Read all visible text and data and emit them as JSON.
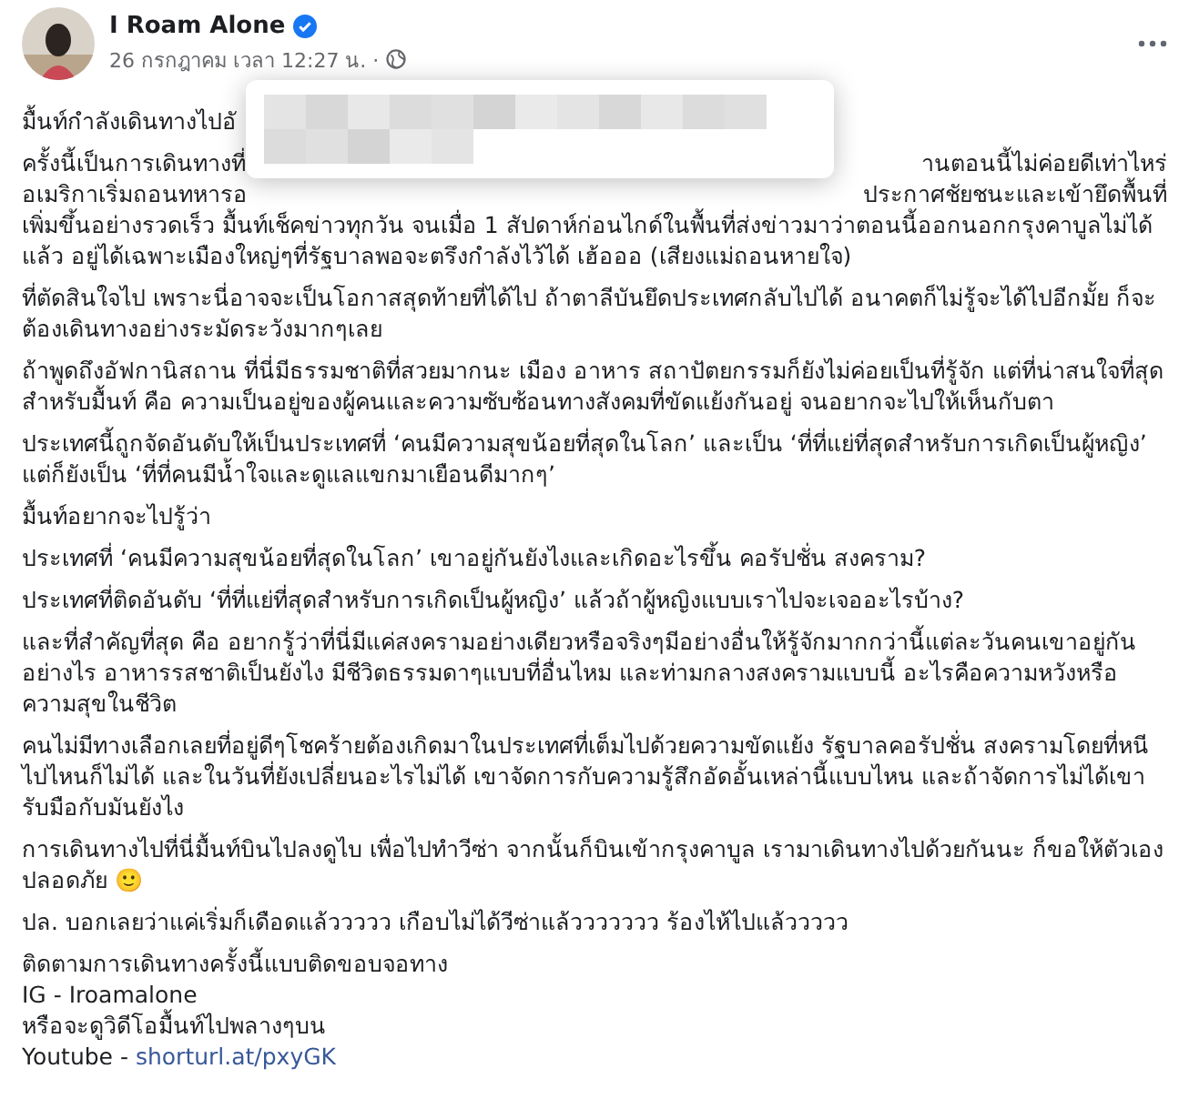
{
  "post": {
    "author": "I Roam Alone",
    "verified": true,
    "time": "26 กรกฎาคม เวลา 12:27 น. ·",
    "intro": "มื้นท์กำลังเดินทางไปอั",
    "partial_lines": [
      {
        "left": "ครั้งนี้เป็นการเดินทางที่",
        "right": "านตอนนี้ไม่ค่อยดีเท่าไหร่"
      },
      {
        "left": "อเมริกาเริ่มถอนทหารอ",
        "right": "ประกาศชัยชนะและเข้ายึดพื้นที่"
      }
    ],
    "continuation": "เพิ่มขึ้นอย่างรวดเร็ว มื้นท์เช็คข่าวทุกวัน จนเมื่อ 1 สัปดาห์ก่อนไกด์ในพื้นที่ส่งข่าวมาว่าตอนนี้ออกนอกกรุงคาบูลไม่ได้แล้ว อยู่ได้เฉพาะเมืองใหญ่ๆที่รัฐบาลพอจะตรึงกำลังไว้ได้ เฮ้อออ (เสียงแม่ถอนหายใจ)",
    "paragraphs": [
      "ที่ตัดสินใจไป เพราะนี่อาจจะเป็นโอกาสสุดท้ายที่ได้ไป ถ้าตาลีบันยึดประเทศกลับไปได้ อนาคตก็ไม่รู้จะได้ไปอีกมั้ย ก็จะต้องเดินทางอย่างระมัดระวังมากๆเลย",
      "ถ้าพูดถึงอัฟกานิสถาน ที่นี่มีธรรมชาติที่สวยมากนะ เมือง อาหาร สถาปัตยกรรมก็ยังไม่ค่อยเป็นที่รู้จัก แต่ที่น่าสนใจที่สุดสำหรับมื้นท์ คือ ความเป็นอยู่ของผู้คนและความซับซ้อนทางสังคมที่ขัดแย้งกันอยู่ จนอยากจะไปให้เห็นกับตา",
      "ประเทศนี้ถูกจัดอันดับให้เป็นประเทศที่ ‘คนมีความสุขน้อยที่สุดในโลก’ และเป็น ‘ที่ที่แย่ที่สุดสำหรับการเกิดเป็นผู้หญิง’ แต่ก็ยังเป็น ‘ที่ที่คนมีน้ำใจและดูแลแขกมาเยือนดีมากๆ’",
      "มื้นท์อยากจะไปรู้ว่า",
      "ประเทศที่ ‘คนมีความสุขน้อยที่สุดในโลก’ เขาอยู่กันยังไงและเกิดอะไรขึ้น คอรัปชั่น สงคราม?",
      "ประเทศที่ติดอันดับ ‘ที่ที่แย่ที่สุดสำหรับการเกิดเป็นผู้หญิง’ แล้วถ้าผู้หญิงแบบเราไปจะเจออะไรบ้าง?",
      "และที่สำคัญที่สุด คือ อยากรู้ว่าที่นี่มีแค่สงครามอย่างเดียวหรือจริงๆมีอย่างอื่นให้รู้จักมากกว่านี้แต่ละวันคนเขาอยู่กันอย่างไร อาหารรสชาติเป็นยังไง มีชีวิตธรรมดาๆแบบที่อื่นไหม และท่ามกลางสงครามแบบนี้ อะไรคือความหวังหรือความสุขในชีวิต",
      "คนไม่มีทางเลือกเลยที่อยู่ดีๆโชคร้ายต้องเกิดมาในประเทศที่เต็มไปด้วยความขัดแย้ง รัฐบาลคอรัปชั่น สงครามโดยที่หนีไปไหนก็ไม่ได้ และในวันที่ยังเปลี่ยนอะไรไม่ได้ เขาจัดการกับความรู้สึกอัดอั้นเหล่านี้แบบไหน และถ้าจัดการไม่ได้เขารับมือกับมันยังไง",
      "การเดินทางไปที่นี่มื้นท์บินไปลงดูไบ เพื่อไปทำวีซ่า จากนั้นก็บินเข้ากรุงคาบูล เรามาเดินทางไปด้วยกันนะ ก็ขอให้ตัวเองปลอดภัย 🙂",
      "ปล. บอกเลยว่าแค่เริ่มก็เดือดแล้ววววว เกือบไม่ได้วีซ่าแล้ววววววว ร้องไห้ไปแล้ววววว"
    ],
    "footer_lines": [
      {
        "kind": "text",
        "text": "ติดตามการเดินทางครั้งนี้แบบติดขอบจอทาง"
      },
      {
        "kind": "text",
        "text": "IG - Iroamalone"
      },
      {
        "kind": "text",
        "text": "หรือจะดูวิดีโอมื้นท์ไปพลางๆบน"
      },
      {
        "kind": "link",
        "text": "Youtube -",
        "link": "shorturl.at/pxyGK"
      }
    ]
  }
}
